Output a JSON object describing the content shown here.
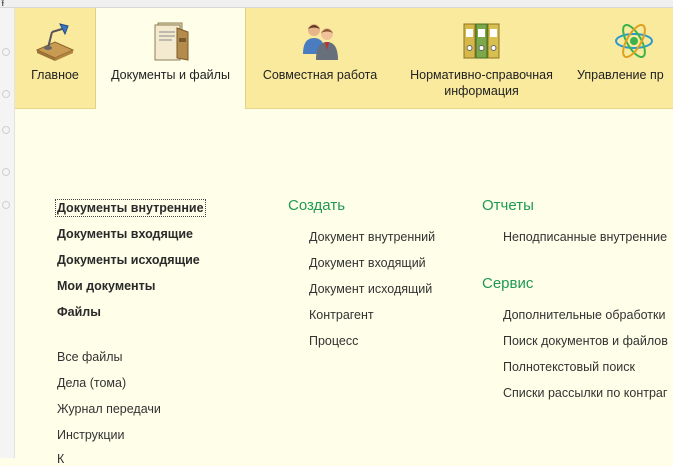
{
  "tabs": [
    {
      "label": "Главное",
      "icon": "desk-lamp-icon"
    },
    {
      "label": "Документы и файлы",
      "icon": "document-folder-icon"
    },
    {
      "label": "Совместная работа",
      "icon": "users-icon"
    },
    {
      "label": "Нормативно-справочная информация",
      "icon": "binders-icon"
    },
    {
      "label": "Управление пр",
      "icon": "process-gear-icon"
    }
  ],
  "left_section": {
    "bold_items": [
      "Документы внутренние",
      "Документы входящие",
      "Документы исходящие",
      "Мои документы",
      "Файлы"
    ],
    "items": [
      "Все файлы",
      "Дела (тома)",
      "Журнал передачи",
      "Инструкции",
      "К"
    ]
  },
  "create_section": {
    "title": "Создать",
    "items": [
      "Документ внутренний",
      "Документ входящий",
      "Документ исходящий",
      "Контрагент",
      "Процесс"
    ]
  },
  "reports_section": {
    "title": "Отчеты",
    "items": [
      "Неподписанные внутренние"
    ]
  },
  "service_section": {
    "title": "Сервис",
    "items": [
      "Дополнительные обработки",
      "Поиск документов и файлов",
      "Полнотекстовый поиск",
      "Списки рассылки по контраг"
    ]
  },
  "colors": {
    "tab_bar": "#f9ea9e",
    "content_bg": "#fefee9",
    "section_header": "#1f9a52"
  }
}
